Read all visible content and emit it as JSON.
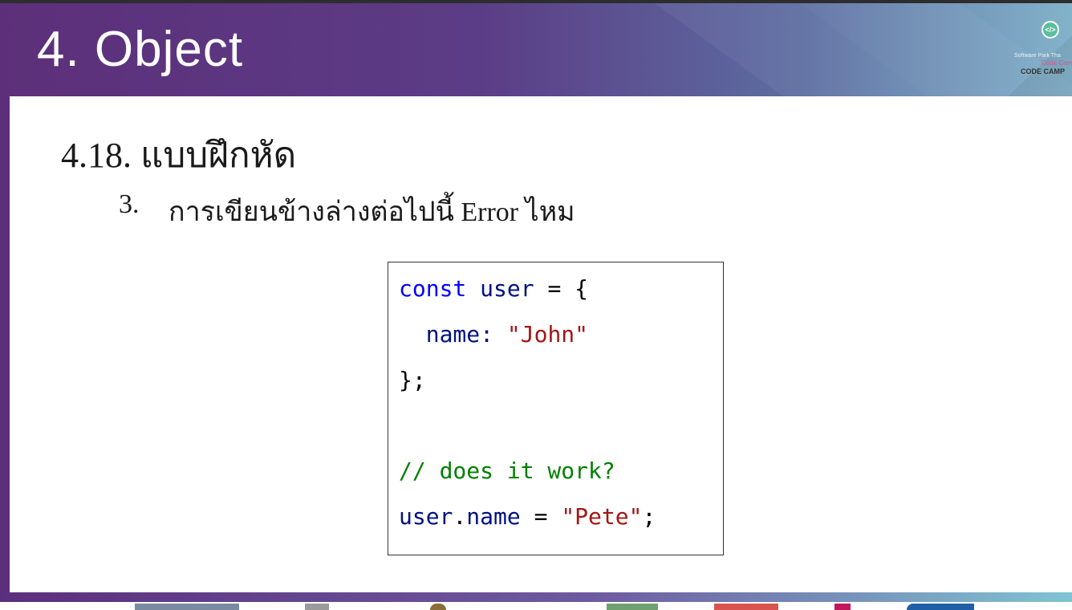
{
  "header": {
    "title": "4. Object",
    "logo": {
      "icon": "code-icon",
      "glyph": "</>",
      "line1": "Software Park Tha",
      "line2": "Code Cam",
      "line3": "CODE CAMP"
    }
  },
  "content": {
    "section_heading": "4.18. แบบฝึกหัด",
    "question": {
      "number": "3.",
      "text": "การเขียนข้างล่างต่อไปนี้ Error  ไหม"
    },
    "code": {
      "line1": {
        "keyword": "const",
        "name": "user",
        "rest": " = {"
      },
      "line2": {
        "key": "name:",
        "value": "\"John\""
      },
      "line3": "};",
      "line4": "// does it work?",
      "line5": {
        "obj": "user",
        "dot": ".",
        "prop": "name",
        "eq": " = ",
        "value": "\"Pete\"",
        "end": ";"
      }
    }
  },
  "colors": {
    "header_start": "#5d2f7a",
    "header_end": "#7db0c8",
    "keyword": "#0000ff",
    "identifier": "#001080",
    "string": "#a31515",
    "comment": "#008000"
  },
  "footer": {
    "sponsor_logos": [
      "sponsor-logo-1",
      "sponsor-logo-2",
      "sponsor-logo-3",
      "sponsor-logo-4",
      "sponsor-logo-5",
      "sponsor-logo-6",
      "sponsor-logo-7"
    ]
  }
}
